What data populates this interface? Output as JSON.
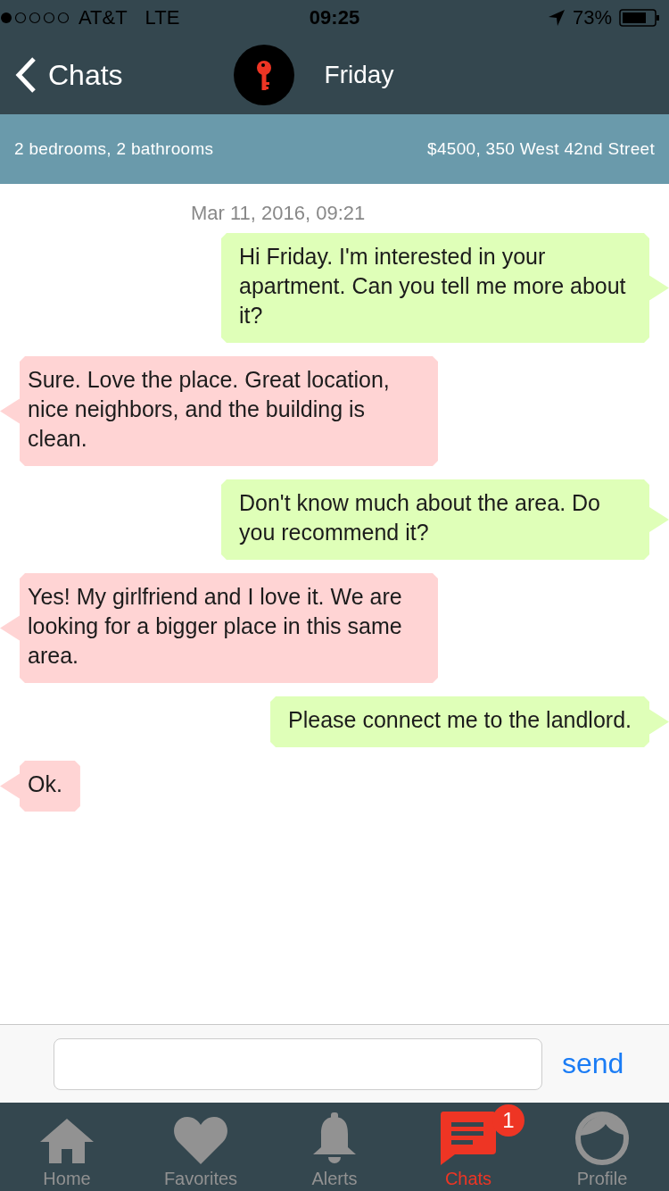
{
  "status_bar": {
    "carrier": "AT&T",
    "network": "LTE",
    "time": "09:25",
    "battery": "73%"
  },
  "nav": {
    "back": "Chats",
    "title": "Friday"
  },
  "listing": {
    "rooms": "2 bedrooms, 2 bathrooms",
    "price_address": "$4500, 350 West 42nd Street"
  },
  "timestamp": "Mar 11, 2016, 09:21",
  "messages": [
    {
      "kind": "sent",
      "text": "Hi Friday. I'm interested in your apartment. Can you tell me more about it?"
    },
    {
      "kind": "received",
      "text": "Sure. Love the place. Great location, nice neighbors, and the building is clean."
    },
    {
      "kind": "sent",
      "text": "Don't know much about the area. Do you recommend it?"
    },
    {
      "kind": "received",
      "text": "Yes! My girlfriend and I love it. We are looking for a bigger place in this same area."
    },
    {
      "kind": "sent",
      "text": "Please connect me to the landlord."
    },
    {
      "kind": "received",
      "text": "Ok."
    }
  ],
  "composer": {
    "send": "send"
  },
  "tabs": [
    {
      "kind": "home",
      "label": "Home",
      "selected": false
    },
    {
      "kind": "favorites",
      "label": "Favorites",
      "selected": false
    },
    {
      "kind": "alerts",
      "label": "Alerts",
      "selected": false
    },
    {
      "kind": "chats",
      "label": "Chats",
      "selected": true,
      "badge": "1"
    },
    {
      "kind": "profile",
      "label": "Profile",
      "selected": false
    }
  ]
}
